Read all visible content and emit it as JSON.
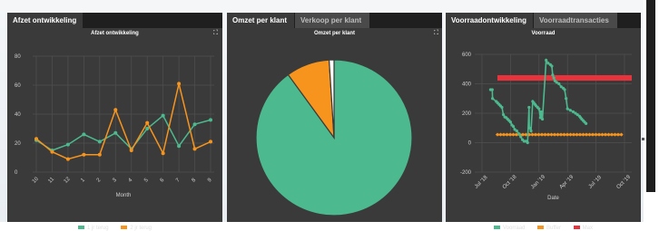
{
  "colors": {
    "green": "#4cb98f",
    "orange": "#f7941d",
    "red": "#e8323c",
    "panel": "#3a3a3a",
    "grid": "#555555"
  },
  "panel1": {
    "tab": "Afzet ontwikkeling",
    "expand_icon": "expand-icon",
    "chart_data": {
      "type": "line",
      "title": "Afzet ontwikkeling",
      "xlabel": "Month",
      "ylabel": "",
      "ylim": [
        0,
        80
      ],
      "yticks": [
        "80",
        "60",
        "40",
        "20",
        "0"
      ],
      "categories": [
        "10",
        "11",
        "12",
        "1",
        "2",
        "3",
        "4",
        "5",
        "6",
        "7",
        "8",
        "9"
      ],
      "series": [
        {
          "name": "1 jr terug",
          "color": "#4cb98f",
          "values": [
            22,
            15,
            19,
            26,
            21,
            27,
            16,
            30,
            39,
            18,
            33,
            36
          ]
        },
        {
          "name": "2 jr terug",
          "color": "#f7941d",
          "values": [
            23,
            14,
            9,
            12,
            12,
            43,
            15,
            34,
            13,
            61,
            16,
            21
          ]
        }
      ],
      "grid": true
    }
  },
  "panel2": {
    "tabs": [
      "Omzet per klant",
      "Verkoop per klant"
    ],
    "expand_icon": "expand-icon",
    "chart_data": {
      "type": "pie",
      "title": "Omzet per klant",
      "slices": [
        {
          "value": 90,
          "color": "#4cb98f"
        },
        {
          "value": 9,
          "color": "#f7941d"
        },
        {
          "value": 1,
          "color": "#ffffff"
        }
      ]
    }
  },
  "panel3": {
    "tabs": [
      "Voorraadontwikkeling",
      "Voorraadtransacties"
    ],
    "chart_data": {
      "type": "line",
      "title": "Voorraad",
      "xlabel": "Date",
      "ylim": [
        -200,
        600
      ],
      "yticks": [
        "600",
        "400",
        "200",
        "0",
        "-200"
      ],
      "categories": [
        "Jul '18",
        "Oct '18",
        "Jan '19",
        "Apr '19",
        "Jul '19",
        "Oct '19"
      ],
      "series": [
        {
          "name": "Voorraad",
          "color": "#4cb98f",
          "x": [
            0.3,
            0.36,
            0.37,
            0.5,
            0.55,
            0.6,
            0.65,
            0.7,
            0.75,
            0.8,
            0.85,
            0.9,
            0.95,
            1.0,
            1.05,
            1.1,
            1.15,
            1.22,
            1.3,
            1.36,
            1.42,
            1.48,
            1.55,
            1.6,
            1.65,
            1.66,
            1.72,
            1.78,
            1.82,
            1.86,
            1.9,
            1.95,
            2.0,
            2.05,
            2.07,
            2.12,
            2.25,
            2.32,
            2.4,
            2.45,
            2.48,
            2.52,
            2.56,
            2.62,
            2.7,
            2.78,
            2.85,
            2.9,
            2.95,
            3.0,
            3.1,
            3.2,
            3.28,
            3.35,
            3.42,
            3.46,
            3.5,
            3.55,
            3.6,
            3.65
          ],
          "values": [
            360,
            360,
            300,
            280,
            270,
            260,
            250,
            240,
            190,
            175,
            170,
            160,
            150,
            140,
            120,
            110,
            90,
            80,
            60,
            40,
            20,
            10,
            10,
            0,
            240,
            100,
            80,
            280,
            270,
            260,
            250,
            240,
            230,
            170,
            210,
            160,
            560,
            540,
            530,
            520,
            460,
            440,
            420,
            410,
            400,
            380,
            370,
            360,
            300,
            230,
            220,
            210,
            200,
            190,
            180,
            170,
            160,
            150,
            140,
            130
          ]
        },
        {
          "name": "Buffer",
          "color": "#f7941d",
          "values": [
            55
          ]
        },
        {
          "name": "Max",
          "color": "#e8323c",
          "values": [
            440
          ]
        }
      ]
    }
  }
}
